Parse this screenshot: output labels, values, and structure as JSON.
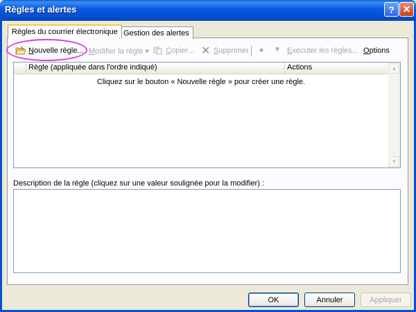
{
  "window": {
    "title": "Règles et alertes"
  },
  "tabs": [
    {
      "label": "Règles du courrier électronique",
      "active": true
    },
    {
      "label": "Gestion des alertes",
      "active": false
    }
  ],
  "toolbar": {
    "new_rule": {
      "prefix": "",
      "mnemonic": "N",
      "rest": "ouvelle règle..."
    },
    "modify_rule": {
      "mnemonic": "M",
      "rest": "odifier la règle ▾"
    },
    "copy": {
      "prefix": "",
      "mnemonic": "C",
      "rest": "opier..."
    },
    "delete": {
      "mnemonic": "S",
      "rest": "upprimer"
    },
    "run_rules": {
      "mnemonic": "E",
      "rest": "xécuter les règles..."
    },
    "options": {
      "mnemonic": "O",
      "rest": "ptions"
    }
  },
  "rules_list": {
    "columns": [
      "Règle (appliquée dans l'ordre indiqué)",
      "Actions"
    ],
    "empty_message": "Cliquez sur le bouton « Nouvelle règle » pour créer une règle."
  },
  "description": {
    "label": "Description de la règle (cliquez sur une valeur soulignée pour la modifier) :"
  },
  "buttons": {
    "ok": "OK",
    "cancel": "Annuler",
    "apply": "Appliquer"
  },
  "colors": {
    "titlebar": "#0550d0",
    "highlight_ring": "#d440e0",
    "dialog_bg": "#ece9d8"
  }
}
